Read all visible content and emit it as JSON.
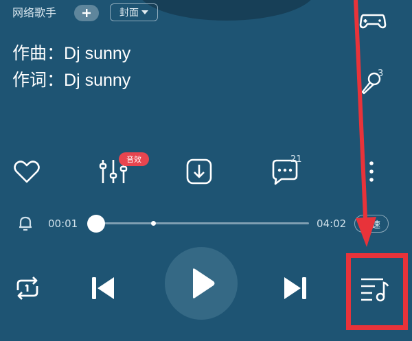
{
  "header": {
    "singer": "网络歌手",
    "follow_label": "+",
    "cover_label": "封面"
  },
  "credits": {
    "composer_label": "作曲：",
    "composer": "Dj sunny",
    "lyricist_label": "作词：",
    "lyricist": "Dj sunny"
  },
  "side": {
    "game_icon": "gamepad-icon",
    "sing_icon": "microphone-icon",
    "sing_count": "3"
  },
  "actions": {
    "like_icon": "heart-icon",
    "effect_icon": "equalizer-icon",
    "effect_badge": "音效",
    "download_icon": "download-icon",
    "comment_icon": "comment-icon",
    "comment_count": "21",
    "more_icon": "more-vertical-icon"
  },
  "progress": {
    "current_time": "00:01",
    "total_time": "04:02",
    "speed_label": "倍速",
    "progress_fraction": 0.004,
    "timer_icon": "bell-icon"
  },
  "controls": {
    "repeat_icon": "repeat-one-icon",
    "prev_icon": "skip-previous-icon",
    "play_icon": "play-icon",
    "next_icon": "skip-next-icon",
    "playlist_icon": "playlist-icon"
  },
  "colors": {
    "background": "#1e5473",
    "annotation": "#e8333a",
    "badge": "#e8454f"
  }
}
